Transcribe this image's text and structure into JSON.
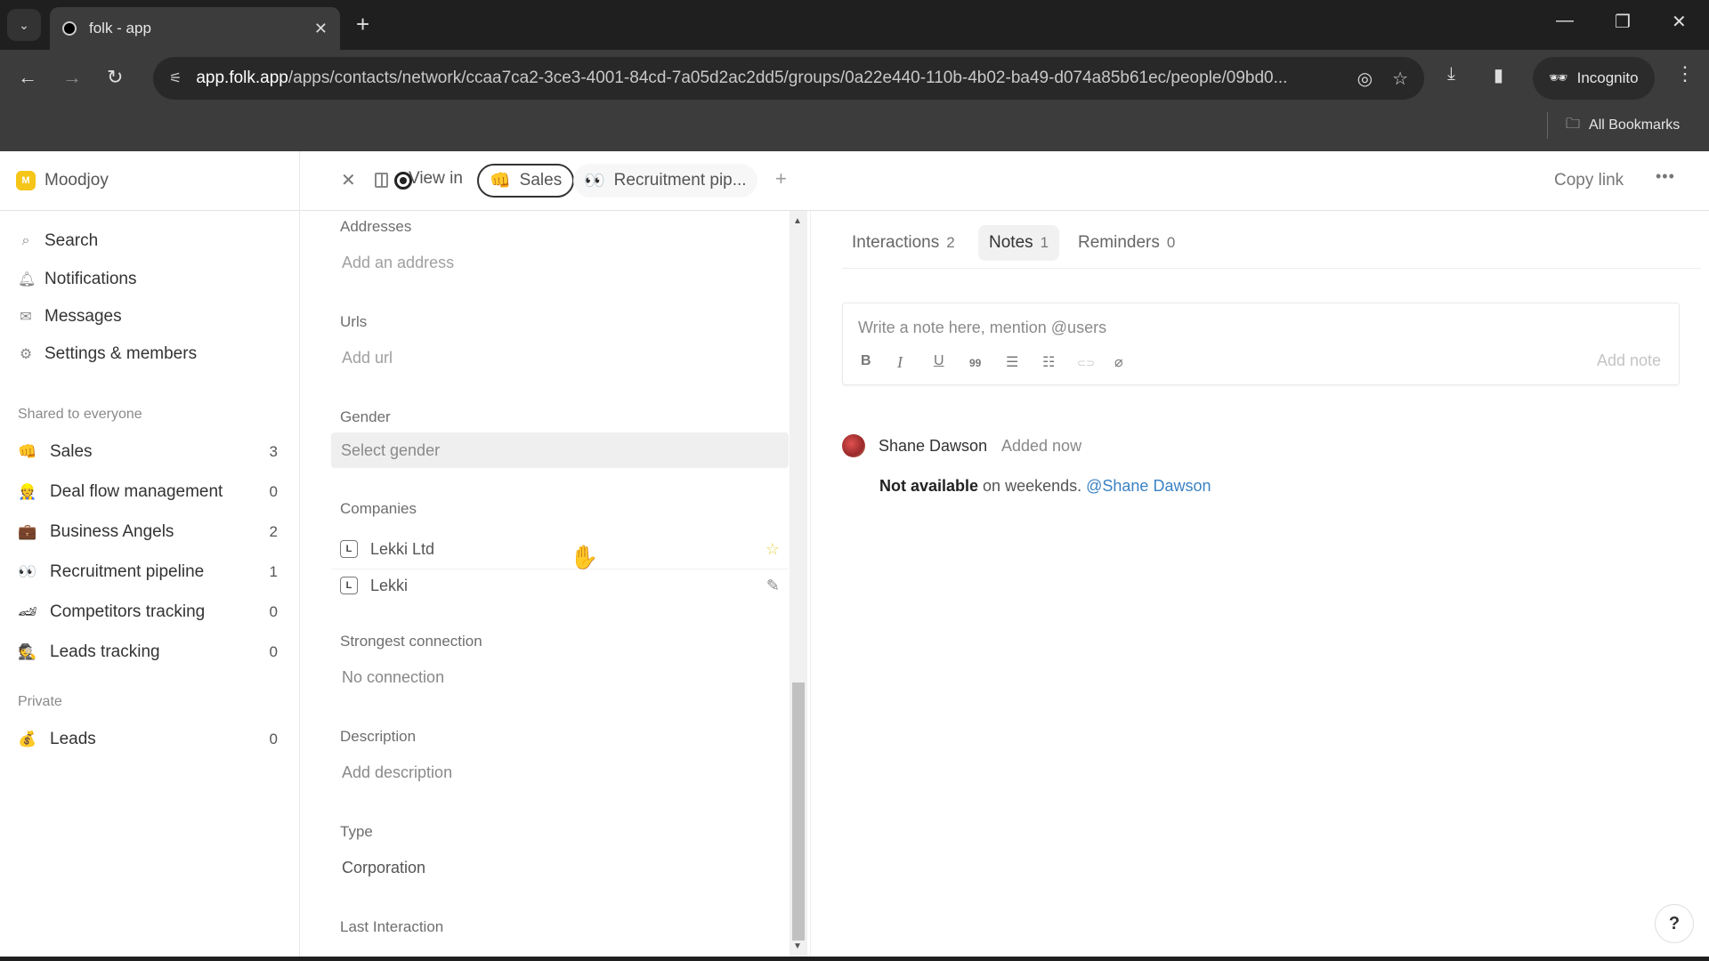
{
  "browser": {
    "tab_title": "folk - app",
    "url_host": "app.folk.app",
    "url_path": "/apps/contacts/network/ccaa7ca2-3ce3-4001-84cd-7a05d2ac2dd5/groups/0a22e440-110b-4b02-ba49-d074a85b61ec/people/09bd0...",
    "incognito_label": "Incognito",
    "bookmarks_label": "All Bookmarks"
  },
  "sidebar": {
    "workspace": {
      "logo_letter": "M",
      "name": "Moodjoy",
      "logo_color": "#f5c518"
    },
    "nav": [
      {
        "icon": "search-icon",
        "glyph": "⌕",
        "label": "Search"
      },
      {
        "icon": "bell-icon",
        "glyph": "🔔︎",
        "label": "Notifications"
      },
      {
        "icon": "mail-icon",
        "glyph": "✉",
        "label": "Messages"
      },
      {
        "icon": "gear-icon",
        "glyph": "⚙",
        "label": "Settings & members"
      }
    ],
    "shared_label": "Shared to everyone",
    "shared_groups": [
      {
        "emoji": "👊",
        "label": "Sales",
        "count": "3"
      },
      {
        "emoji": "👷",
        "label": "Deal flow management",
        "count": "0"
      },
      {
        "emoji": "💼",
        "label": "Business Angels",
        "count": "2"
      },
      {
        "emoji": "👀",
        "label": "Recruitment pipeline",
        "count": "1"
      },
      {
        "emoji": "🏎",
        "label": "Competitors tracking",
        "count": "0"
      },
      {
        "emoji": "🕵",
        "label": "Leads tracking",
        "count": "0"
      }
    ],
    "private_label": "Private",
    "private_groups": [
      {
        "emoji": "💰",
        "label": "Leads",
        "count": "0"
      }
    ]
  },
  "header": {
    "view_in_label": "View in",
    "chips": [
      {
        "emoji": "👊",
        "label": "Sales",
        "active": true
      },
      {
        "emoji": "👀",
        "label": "Recruitment pip...",
        "active": false
      }
    ],
    "copy_link_label": "Copy link",
    "more_label": "•••"
  },
  "details": {
    "addresses": {
      "label": "Addresses",
      "value": "Add an address"
    },
    "urls": {
      "label": "Urls",
      "value": "Add url"
    },
    "gender": {
      "label": "Gender",
      "value": "Select gender"
    },
    "companies": {
      "label": "Companies",
      "items": [
        {
          "logo": "L",
          "name": "Lekki Ltd",
          "action": "star-icon",
          "action_glyph": "☆"
        },
        {
          "logo": "L",
          "name": "Lekki",
          "action": "magic-wand-icon",
          "action_glyph": "🪄"
        }
      ]
    },
    "strongest_connection": {
      "label": "Strongest connection",
      "value": "No connection"
    },
    "description": {
      "label": "Description",
      "value": "Add description"
    },
    "type": {
      "label": "Type",
      "value": "Corporation"
    },
    "last_interaction": {
      "label": "Last Interaction"
    }
  },
  "activity": {
    "tabs": [
      {
        "label": "Interactions",
        "count": "2",
        "active": false
      },
      {
        "label": "Notes",
        "count": "1",
        "active": true
      },
      {
        "label": "Reminders",
        "count": "0",
        "active": false
      }
    ],
    "composer": {
      "placeholder": "Write a note here, mention @users",
      "add_note_label": "Add note",
      "format_buttons": [
        {
          "name": "bold-icon",
          "glyph": "B"
        },
        {
          "name": "italic-icon",
          "glyph": "I"
        },
        {
          "name": "underline-icon",
          "glyph": "U"
        },
        {
          "name": "quote-icon",
          "glyph": "99"
        },
        {
          "name": "bullet-list-icon",
          "glyph": "☰"
        },
        {
          "name": "numbered-list-icon",
          "glyph": "☷"
        },
        {
          "name": "link-icon",
          "glyph": "⊂⊃"
        },
        {
          "name": "attachment-icon",
          "glyph": "📎"
        }
      ]
    },
    "notes": [
      {
        "author": "Shane Dawson",
        "time": "Added now",
        "body_bold": "Not available",
        "body_text": " on weekends. ",
        "mention": "@Shane Dawson",
        "mention_color": "#3b82c4"
      }
    ]
  },
  "help_label": "?"
}
